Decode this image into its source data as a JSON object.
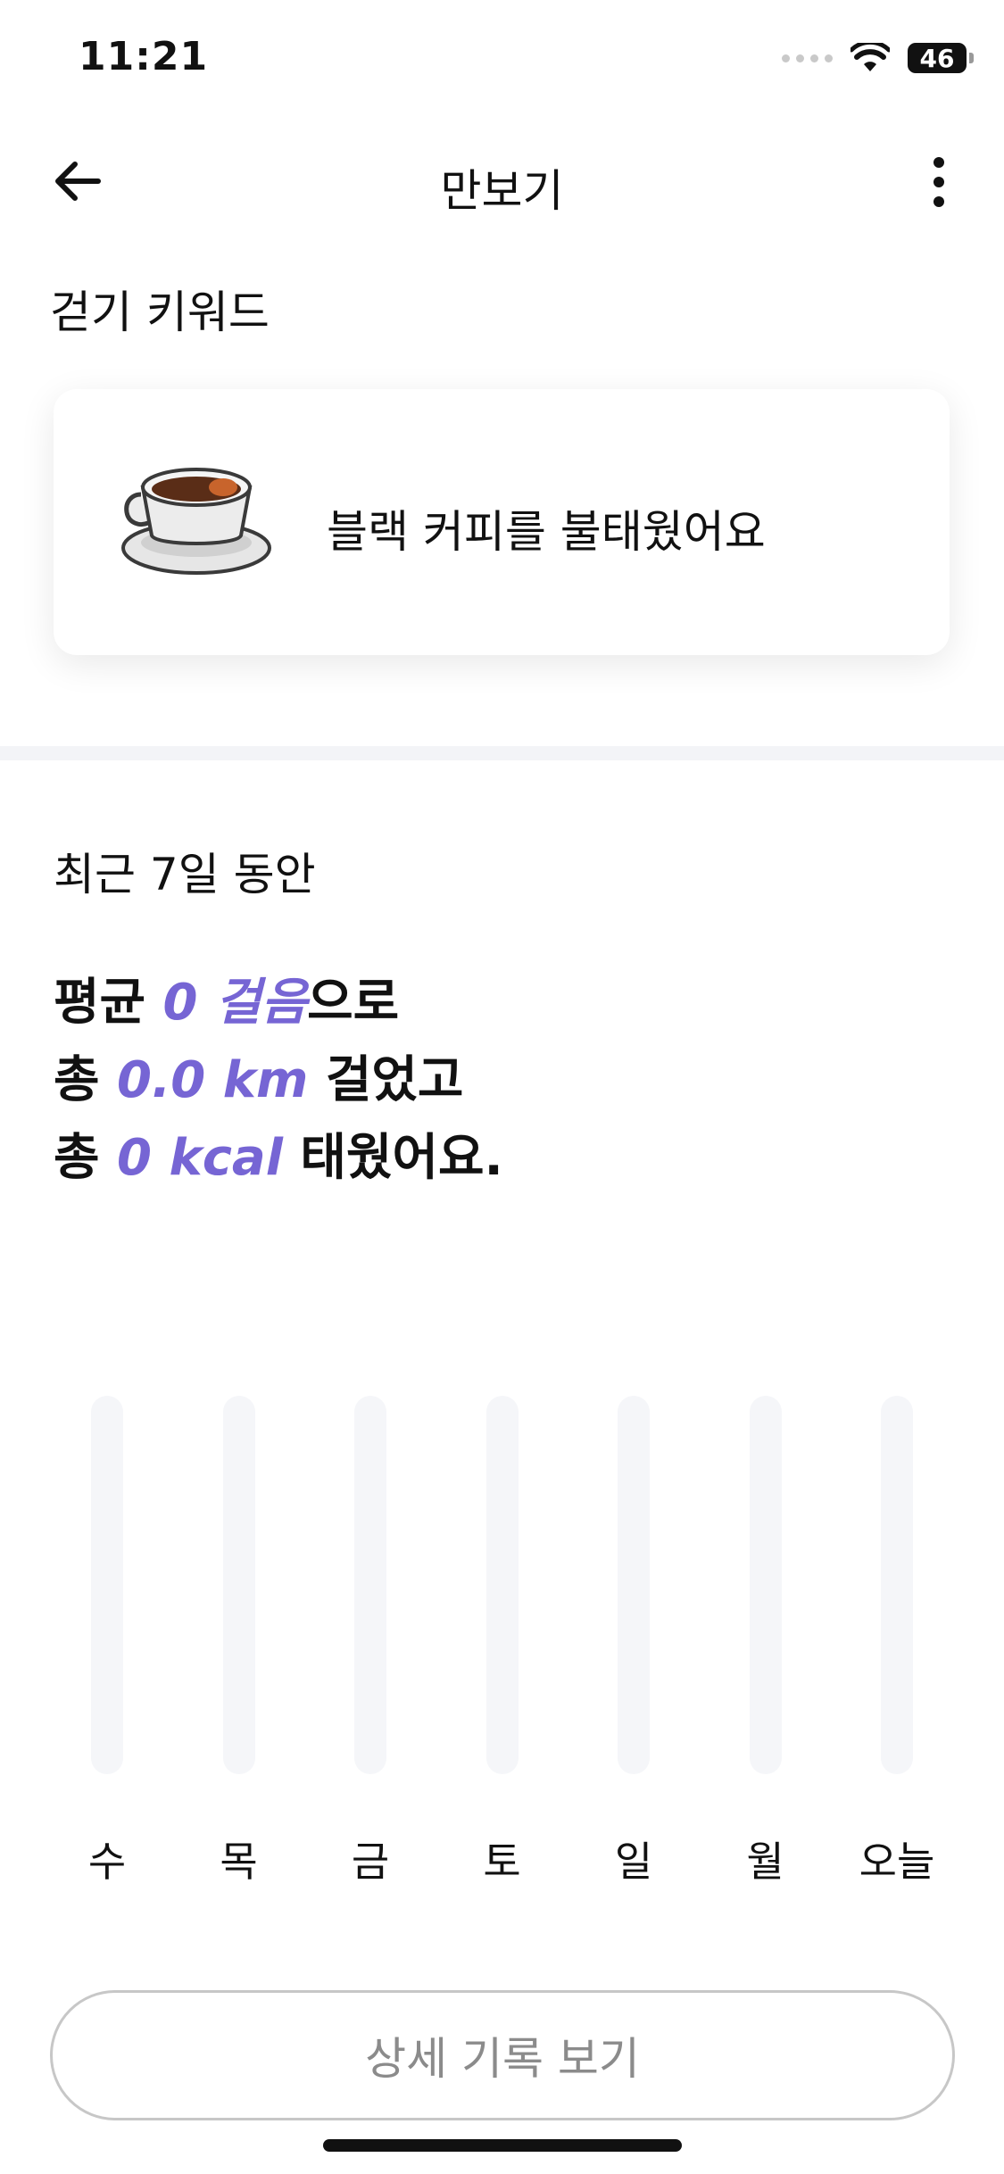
{
  "status_bar": {
    "time": "11:21",
    "battery": "46",
    "icons": [
      "signal-icon",
      "wifi-icon",
      "battery-icon"
    ]
  },
  "nav": {
    "title": "만보기",
    "icons": [
      "arrow-left-icon",
      "more-vertical-icon"
    ]
  },
  "keyword": {
    "section_label": "걷기 키워드",
    "text": "블랙 커피를 불태웠어요",
    "icon": "coffee-cup-icon"
  },
  "summary": {
    "period_label": "최근 7일 동안",
    "line1_prefix": "평균 ",
    "steps": "0 걸음",
    "line1_suffix": "으로",
    "line2_prefix": "총 ",
    "distance": "0.0 km",
    "line2_suffix": " 걸었고",
    "line3_prefix": "총 ",
    "calories": "0 kcal",
    "line3_suffix": " 태웠어요."
  },
  "chart_data": {
    "type": "bar",
    "categories": [
      "수",
      "목",
      "금",
      "토",
      "일",
      "월",
      "오늘"
    ],
    "values": [
      0,
      0,
      0,
      0,
      0,
      0,
      0
    ]
  },
  "detail_button": {
    "label": "상세 기록 보기"
  },
  "colors": {
    "accent": "#7665d4",
    "bar_track": "#f5f6f9",
    "divider": "#f3f4f7",
    "button_text": "#8b8b8b"
  }
}
